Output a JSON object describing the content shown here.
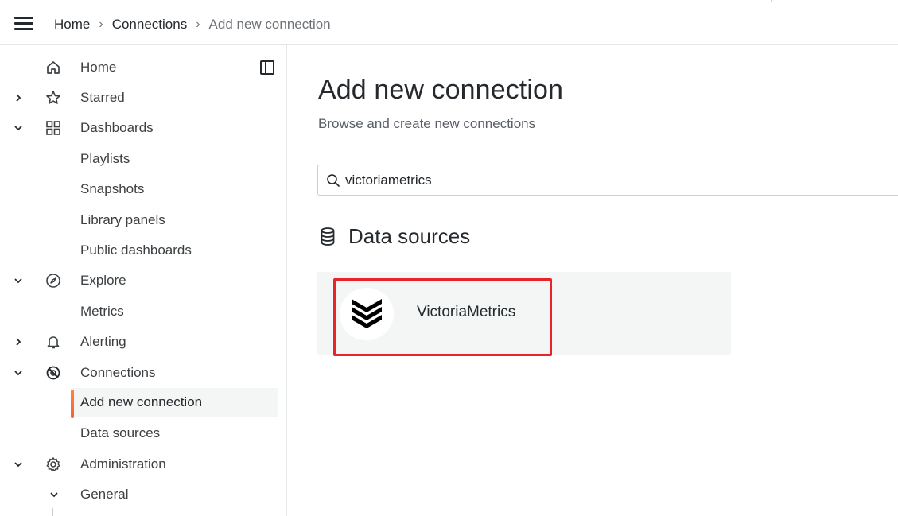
{
  "header": {
    "menu_icon": "hamburger-icon",
    "breadcrumb": [
      {
        "label": "Home"
      },
      {
        "label": "Connections"
      },
      {
        "label": "Add new connection"
      }
    ],
    "separator": "›"
  },
  "sidebar": {
    "dock_icon": "dock-sidebar-icon",
    "items": [
      {
        "label": "Home",
        "icon": "home-icon"
      },
      {
        "label": "Starred",
        "icon": "star-icon",
        "expander": "collapsed"
      },
      {
        "label": "Dashboards",
        "icon": "dashboards-grid-icon",
        "expander": "expanded"
      },
      {
        "label": "Playlists"
      },
      {
        "label": "Snapshots"
      },
      {
        "label": "Library panels"
      },
      {
        "label": "Public dashboards"
      },
      {
        "label": "Explore",
        "icon": "compass-icon",
        "expander": "expanded"
      },
      {
        "label": "Metrics"
      },
      {
        "label": "Alerting",
        "icon": "bell-icon",
        "expander": "collapsed"
      },
      {
        "label": "Connections",
        "icon": "connections-icon",
        "expander": "expanded"
      },
      {
        "label": "Add new connection",
        "active": true
      },
      {
        "label": "Data sources"
      },
      {
        "label": "Administration",
        "icon": "gear-icon",
        "expander": "expanded"
      },
      {
        "label": "General",
        "expander": "expanded"
      }
    ]
  },
  "main": {
    "title": "Add new connection",
    "subtitle": "Browse and create new connections",
    "search": {
      "value": "victoriametrics",
      "icon": "search-icon"
    },
    "section": {
      "title": "Data sources",
      "icon": "database-icon"
    },
    "cards": [
      {
        "name": "VictoriaMetrics",
        "logo": "victoriametrics-logo"
      }
    ]
  },
  "colors": {
    "active_indicator": "#f55f3e",
    "highlight_box": "#e8232a",
    "card_background": "#f4f5f5",
    "text_primary": "#24292e",
    "text_secondary": "#5a5f66"
  }
}
